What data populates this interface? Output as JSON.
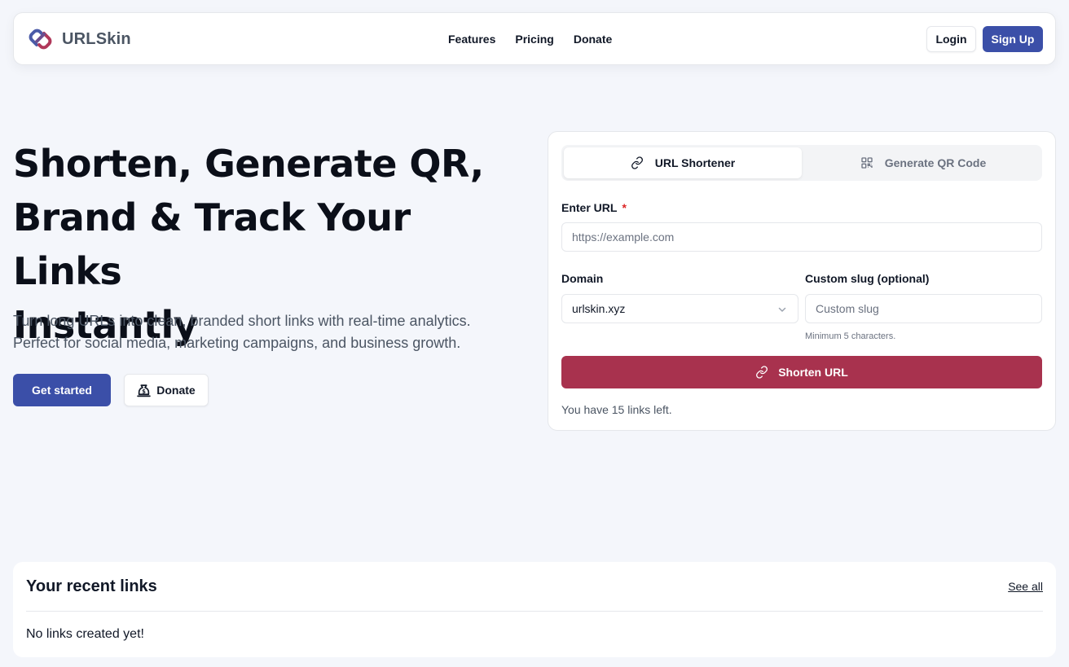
{
  "navbar": {
    "brand": "URLSkin",
    "links": [
      "Features",
      "Pricing",
      "Donate"
    ],
    "login_label": "Login",
    "signup_label": "Sign Up"
  },
  "hero": {
    "title_lines": [
      "Shorten, Generate QR,",
      "Brand & Track Your Links",
      "Instantly"
    ],
    "subtitle_lines": [
      "Turn long URLs into clean, branded short links with real-time analytics.",
      "Perfect for social media, marketing campaigns, and business growth."
    ],
    "get_started_label": "Get started",
    "donate_label": "Donate"
  },
  "form": {
    "tabs": [
      {
        "label": "URL Shortener",
        "icon": "link-icon",
        "active": true
      },
      {
        "label": "Generate QR Code",
        "icon": "qr-code-icon",
        "active": false
      }
    ],
    "url_label": "Enter URL",
    "required_mark": "*",
    "url_placeholder": "https://example.com",
    "url_value": "",
    "domain_label": "Domain",
    "domain_value": "urlskin.xyz",
    "slug_label": "Custom slug (optional)",
    "slug_placeholder": "Custom slug",
    "slug_hint": "Minimum 5 characters.",
    "submit_label": "Shorten URL",
    "links_left_text": "You have 15 links left."
  },
  "recent": {
    "title": "Your recent links",
    "see_all_label": "See all",
    "empty_text": "No links created yet!"
  },
  "colors": {
    "primary": "#3b4fa8",
    "accent": "#a8324e",
    "background": "#f4f6fb",
    "required": "#dc2626"
  }
}
